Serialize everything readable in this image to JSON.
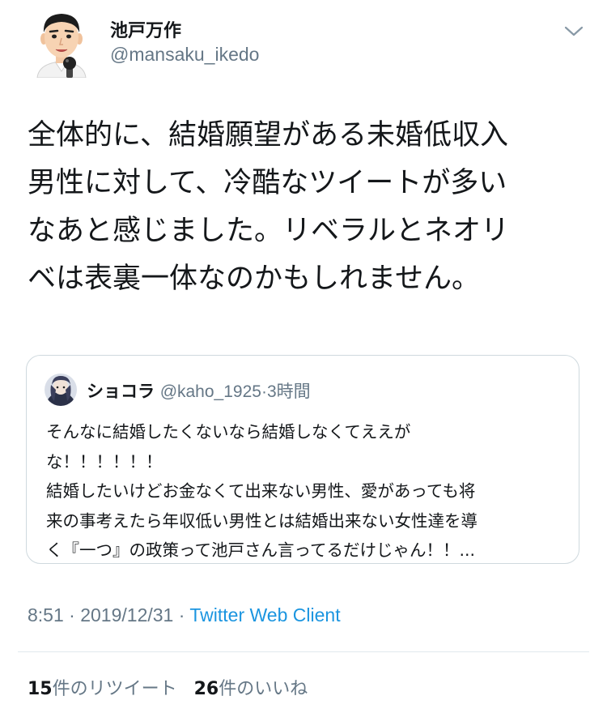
{
  "author": {
    "display_name": "池戸万作",
    "handle": "@mansaku_ikedo"
  },
  "tweet": {
    "text": "全体的に、結婚願望がある未婚低収入\n男性に対して、冷酷なツイートが多い\nなあと感じました。リベラルとネオリ\nベは表裏一体なのかもしれません。"
  },
  "quote": {
    "display_name": "ショコラ",
    "handle": "@kaho_1925",
    "separator": "·",
    "time": "3時間",
    "text": "そんなに結婚したくないなら結婚しなくてええが\nな！！！！！！\n結婚したいけどお金なくて出来ない男性、愛があっても将\n来の事考えたら年収低い男性とは結婚出来ない女性達を導\nく『一つ』の政策って池戸さん言ってるだけじゃん！！..."
  },
  "meta": {
    "time": "8:51",
    "separator": "·",
    "date": "2019/12/31",
    "client": "Twitter Web Client"
  },
  "stats": {
    "retweets_count": "15",
    "retweets_label": "件のリツイート",
    "likes_count": "26",
    "likes_label": "件のいいね"
  },
  "icons": {
    "menu": "chevron-down-icon",
    "avatar": "avatar-caricature",
    "quote_avatar": "avatar-illustration"
  },
  "colors": {
    "text_primary": "#14171a",
    "text_secondary": "#657786",
    "link": "#1b95e0",
    "border": "#cfd9de"
  }
}
